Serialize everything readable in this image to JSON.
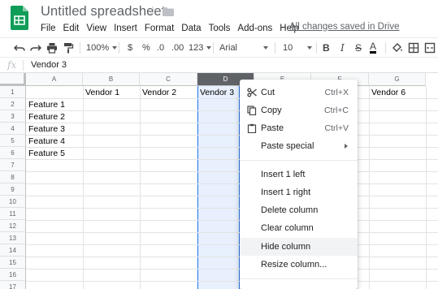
{
  "app": {
    "doc_title": "Untitled spreadsheet",
    "saved_status": "All changes saved in Drive"
  },
  "menu": [
    "File",
    "Edit",
    "View",
    "Insert",
    "Format",
    "Data",
    "Tools",
    "Add-ons",
    "Help"
  ],
  "toolbar": {
    "zoom": "100%",
    "currency": "$",
    "percent": "%",
    "decrease_decimals": ".0",
    "increase_decimals": ".00",
    "more_formats": "123",
    "font": "Arial",
    "font_size": "10",
    "bold": "B",
    "italic": "I",
    "strikethrough": "S",
    "text_color": "A"
  },
  "formula_bar": {
    "fx": "fx",
    "value": "Vendor 3"
  },
  "grid": {
    "columns": [
      "A",
      "B",
      "C",
      "D",
      "E",
      "F",
      "G"
    ],
    "selected_column": "D",
    "rows": [
      "1",
      "2",
      "3",
      "4",
      "5",
      "6",
      "7",
      "8",
      "9",
      "10",
      "11",
      "12",
      "13",
      "14",
      "15",
      "16",
      "17"
    ],
    "cells": {
      "B1": "Vendor 1",
      "C1": "Vendor 2",
      "D1": "Vendor 3",
      "G1": "Vendor 6",
      "A2": "Feature 1",
      "A3": "Feature 2",
      "A4": "Feature 3",
      "A5": "Feature 4",
      "A6": "Feature 5"
    }
  },
  "context_menu": {
    "cut": {
      "label": "Cut",
      "shortcut": "Ctrl+X"
    },
    "copy": {
      "label": "Copy",
      "shortcut": "Ctrl+C"
    },
    "paste": {
      "label": "Paste",
      "shortcut": "Ctrl+V"
    },
    "paste_special": {
      "label": "Paste special"
    },
    "insert_left": {
      "label": "Insert 1 left"
    },
    "insert_right": {
      "label": "Insert 1 right"
    },
    "delete_column": {
      "label": "Delete column"
    },
    "clear_column": {
      "label": "Clear column"
    },
    "hide_column": {
      "label": "Hide column"
    },
    "resize_column": {
      "label": "Resize column..."
    }
  },
  "colors": {
    "brand_green": "#0f9d58",
    "selection_blue": "#1a73e8",
    "selection_fill": "#e8f0fe"
  }
}
